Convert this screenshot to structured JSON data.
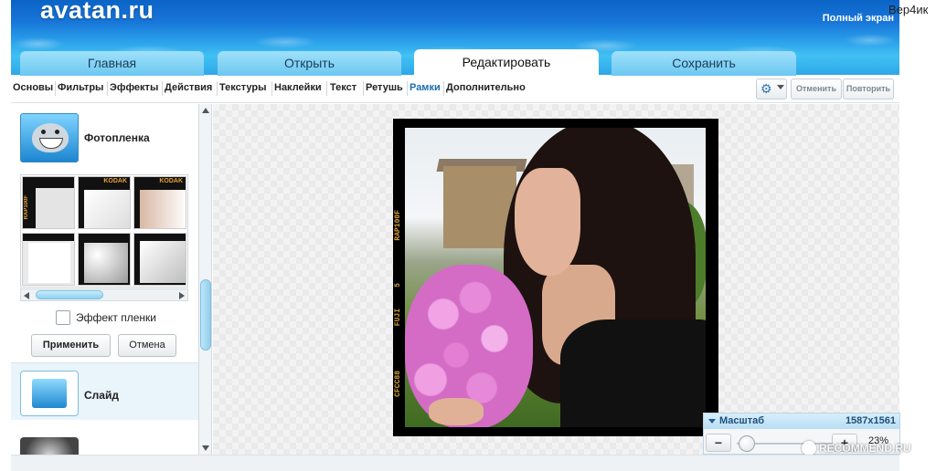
{
  "header": {
    "logo": "avatan.ru",
    "fullscreen_label": "Полный экран",
    "user_name": "Вер4ик"
  },
  "tabs": [
    {
      "label": "Главная",
      "active": false
    },
    {
      "label": "Открыть",
      "active": false
    },
    {
      "label": "Редактировать",
      "active": true
    },
    {
      "label": "Сохранить",
      "active": false
    }
  ],
  "toolnav": {
    "items": [
      "Основы",
      "Фильтры",
      "Эффекты",
      "Действия",
      "Текстуры",
      "Наклейки",
      "Текст",
      "Ретушь",
      "Рамки",
      "Дополнительно"
    ],
    "active_item": "Рамки",
    "undo_label": "Отменить",
    "redo_label": "Повторить"
  },
  "panel": {
    "effect_title": "Фотопленка",
    "thumb_labels": [
      "RAP100F",
      "KODAK",
      "KODAK"
    ],
    "checkbox_label": "Эффект пленки",
    "checkbox_checked": false,
    "apply_label": "Применить",
    "cancel_label": "Отмена",
    "next_effect_title": "Слайд"
  },
  "canvas": {
    "film_labels": [
      "RAP100F",
      "FUJI",
      "CFCC88"
    ],
    "film_number": "5"
  },
  "zoom": {
    "title": "Масштаб",
    "dimensions": "1587x1561",
    "percent": "23%",
    "minus_label": "−",
    "plus_label": "+",
    "slider_value": 0.23
  },
  "watermark": "RECOMMEND.RU",
  "colors": {
    "header_blue": "#1877d9",
    "tab_blue": "#6cc8f1",
    "active_link": "#1a6fb2",
    "film_text": "#d8a33b"
  },
  "icons": [
    "gear-icon",
    "chevron-down-icon",
    "scroll-up-icon",
    "scroll-down-icon"
  ]
}
